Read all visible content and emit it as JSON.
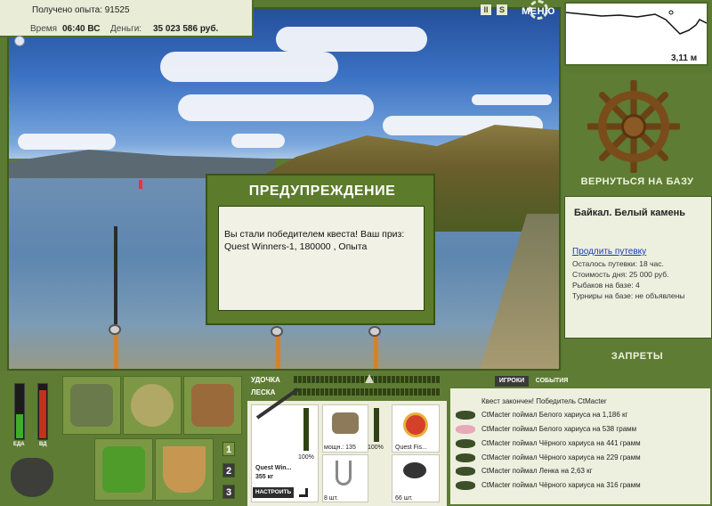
{
  "hud": {
    "xp_text": "Получено опыта: 91525",
    "time_label": "Время",
    "time_value": "06:40 ВС",
    "money_label": "Деньги:",
    "money_value": "35 023 586 руб."
  },
  "top_controls": {
    "pause_label": "II",
    "sound_label": "S",
    "menu_label": "МЕНЮ"
  },
  "depth": {
    "value": "3,11 м"
  },
  "base": {
    "back_label": "ВЕРНУТЬСЯ НА БАЗУ",
    "location": "Байкал. Белый камень",
    "extend_link": "Продлить путевку",
    "lines": [
      "Осталось путевки: 18 час.",
      "Стоимость дня: 25 000 руб.",
      "Рыбаков на базе: 4",
      "Турниры на базе: не объявлены"
    ],
    "bans_label": "ЗАПРЕТЫ"
  },
  "dialog": {
    "title": "ПРЕДУПРЕЖДЕНИЕ",
    "line1": "Вы стали победителем квеста! Ваш приз:",
    "line2": "Quest Winners-1, 180000 , Опыта"
  },
  "meters": {
    "food_label": "ЕДА",
    "vodka_label": "ВД",
    "food_level": 0.45,
    "vodka_level": 0.9
  },
  "pages": [
    "1",
    "2",
    "3"
  ],
  "tackle": {
    "rod_label": "УДОЧКА",
    "line_label": "ЛЕСКА",
    "rod_name": "Quest Win...",
    "rod_weight": "355 кг",
    "rod_percent": "100%",
    "reel_info": "мощн.: 135",
    "reel_percent": "100%",
    "lure_name": "Quest Fis...",
    "hooks_count": "8 шт.",
    "bait_count": "66 шт.",
    "setup_label": "НАСТРОИТЬ"
  },
  "events": {
    "tab_players": "ИГРОКИ",
    "tab_events": "СОБЫТИЯ",
    "header": "Квест закончен! Победитель CtMacter",
    "items": [
      "CtMacter поймал Белого хариуса на 1,186 кг",
      "CtMacter поймал Белого хариуса на 538 грамм",
      "CtMacter поймал Чёрного хариуса на 441 грамм",
      "CtMacter поймал Чёрного хариуса на 229 грамм",
      "CtMacter поймал Ленка на 2,63 кг",
      "CtMacter поймал Чёрного хариуса на 316 грамм"
    ]
  },
  "icons": {
    "tackle_box": "tackle-box-icon",
    "bag": "bag-icon",
    "net": "landing-net-icon",
    "basket": "food-basket-icon",
    "bucket": "bucket-icon",
    "pot": "cauldron-icon",
    "wheel": "ship-wheel-icon"
  },
  "colors": {
    "panel_green": "#5e7c33",
    "dark_green": "#3f5a1f",
    "panel_light": "#eef0df",
    "link": "#1a3ab8"
  }
}
